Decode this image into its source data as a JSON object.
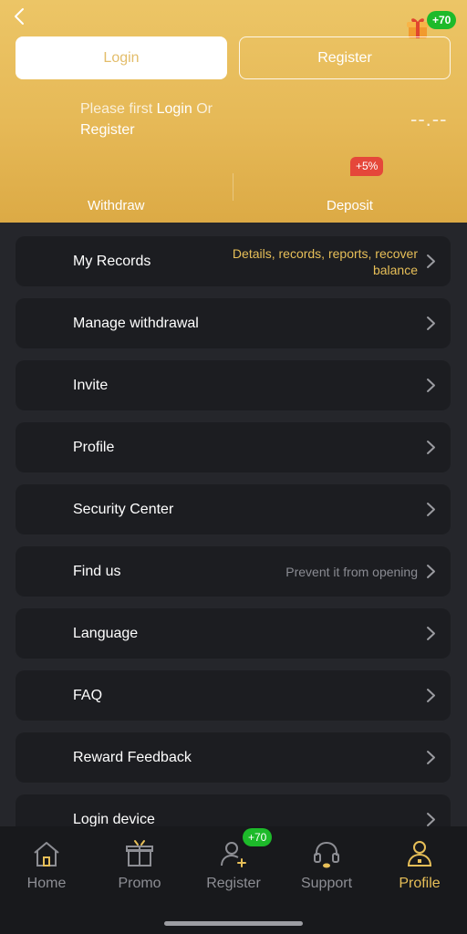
{
  "header": {
    "login_label": "Login",
    "register_label": "Register",
    "gift_badge": "+70",
    "prompt_prefix": "Please first ",
    "prompt_login": "Login",
    "prompt_or": " Or",
    "prompt_register": "Register",
    "balance": "--.--",
    "withdraw_label": "Withdraw",
    "deposit_label": "Deposit",
    "deposit_badge": "+5%",
    "accent": "#e6b957"
  },
  "menu": {
    "items": [
      {
        "label": "My Records",
        "sub": "Details, records, reports, recover balance"
      },
      {
        "label": "Manage withdrawal",
        "sub": ""
      },
      {
        "label": "Invite",
        "sub": ""
      },
      {
        "label": "Profile",
        "sub": ""
      },
      {
        "label": "Security Center",
        "sub": ""
      },
      {
        "label": "Find us",
        "sub": "Prevent it from opening"
      },
      {
        "label": "Language",
        "sub": ""
      },
      {
        "label": "FAQ",
        "sub": ""
      },
      {
        "label": "Reward Feedback",
        "sub": ""
      },
      {
        "label": "Login device",
        "sub": ""
      }
    ]
  },
  "nav": {
    "items": [
      {
        "label": "Home",
        "icon": "home-icon"
      },
      {
        "label": "Promo",
        "icon": "gift-icon"
      },
      {
        "label": "Register",
        "icon": "add-user-icon"
      },
      {
        "label": "Support",
        "icon": "headset-icon"
      },
      {
        "label": "Profile",
        "icon": "user-icon"
      }
    ],
    "register_badge": "+70",
    "active_color": "#e7bf58"
  }
}
